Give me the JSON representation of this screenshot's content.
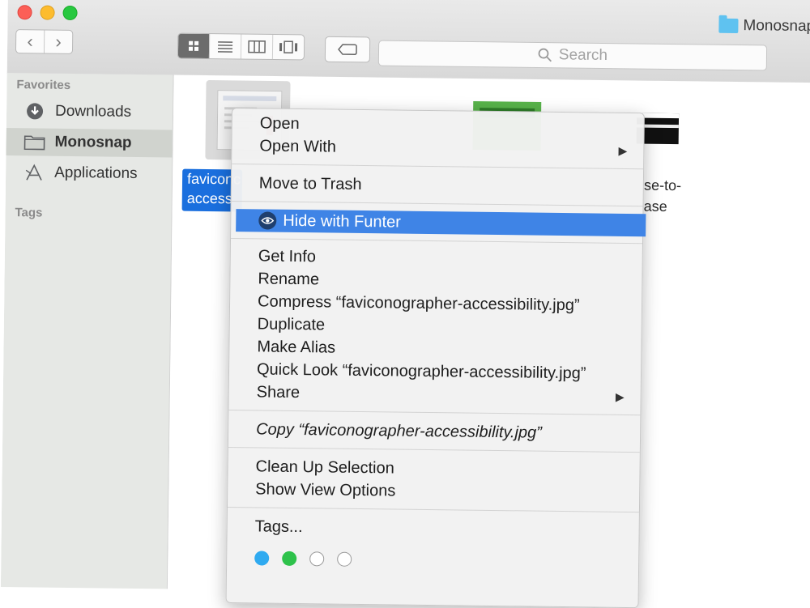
{
  "window": {
    "title": "Monosnap",
    "search_placeholder": "Search"
  },
  "sidebar": {
    "favorites_header": "Favorites",
    "items": [
      {
        "label": "Downloads",
        "icon": "download-icon",
        "selected": false
      },
      {
        "label": "Monosnap",
        "icon": "folder-icon",
        "selected": true
      },
      {
        "label": "Applications",
        "icon": "applications-icon",
        "selected": false
      }
    ],
    "tags_header": "Tags"
  },
  "files": {
    "selected_name_lines": [
      "faviconc",
      "access"
    ],
    "third_name_lines": [
      "se-to-",
      "ase"
    ]
  },
  "context_menu": {
    "open": "Open",
    "open_with": "Open With",
    "move_to_trash": "Move to Trash",
    "hide_with_funter": "Hide with Funter",
    "get_info": "Get Info",
    "rename": "Rename",
    "compress": "Compress “faviconographer-accessibility.jpg”",
    "duplicate": "Duplicate",
    "make_alias": "Make Alias",
    "quick_look": "Quick Look “faviconographer-accessibility.jpg”",
    "share": "Share",
    "copy": "Copy “faviconographer-accessibility.jpg”",
    "clean_up_selection": "Clean Up Selection",
    "show_view_options": "Show View Options",
    "tags": "Tags...",
    "tag_colors": [
      "#2faaf0",
      "#2ec24b",
      "none",
      "none"
    ],
    "highlight_color": "#3f84e6"
  }
}
